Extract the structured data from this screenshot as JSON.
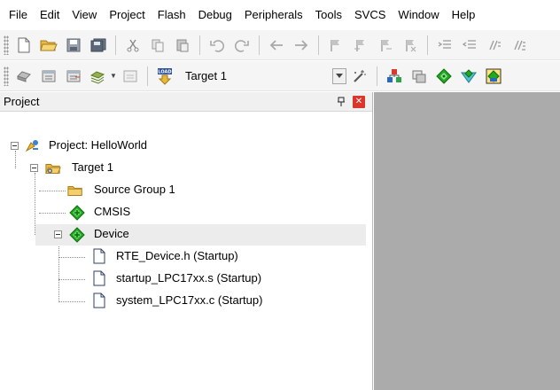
{
  "menu": [
    "File",
    "Edit",
    "View",
    "Project",
    "Flash",
    "Debug",
    "Peripherals",
    "Tools",
    "SVCS",
    "Window",
    "Help"
  ],
  "toolbar": {
    "target_value": "Target 1",
    "load_badge": "LOAD"
  },
  "panel": {
    "title": "Project"
  },
  "tree": {
    "project": "Project: HelloWorld",
    "target": "Target 1",
    "source_group": "Source Group 1",
    "cmsis": "CMSIS",
    "device": "Device",
    "files": [
      "RTE_Device.h (Startup)",
      "startup_LPC17xx.s (Startup)",
      "system_LPC17xx.c (Startup)"
    ]
  },
  "colors": {
    "editor_bg": "#ababab",
    "selection_bg": "#ececec",
    "close_button": "#d9372b",
    "rte_green": "#22a822"
  }
}
